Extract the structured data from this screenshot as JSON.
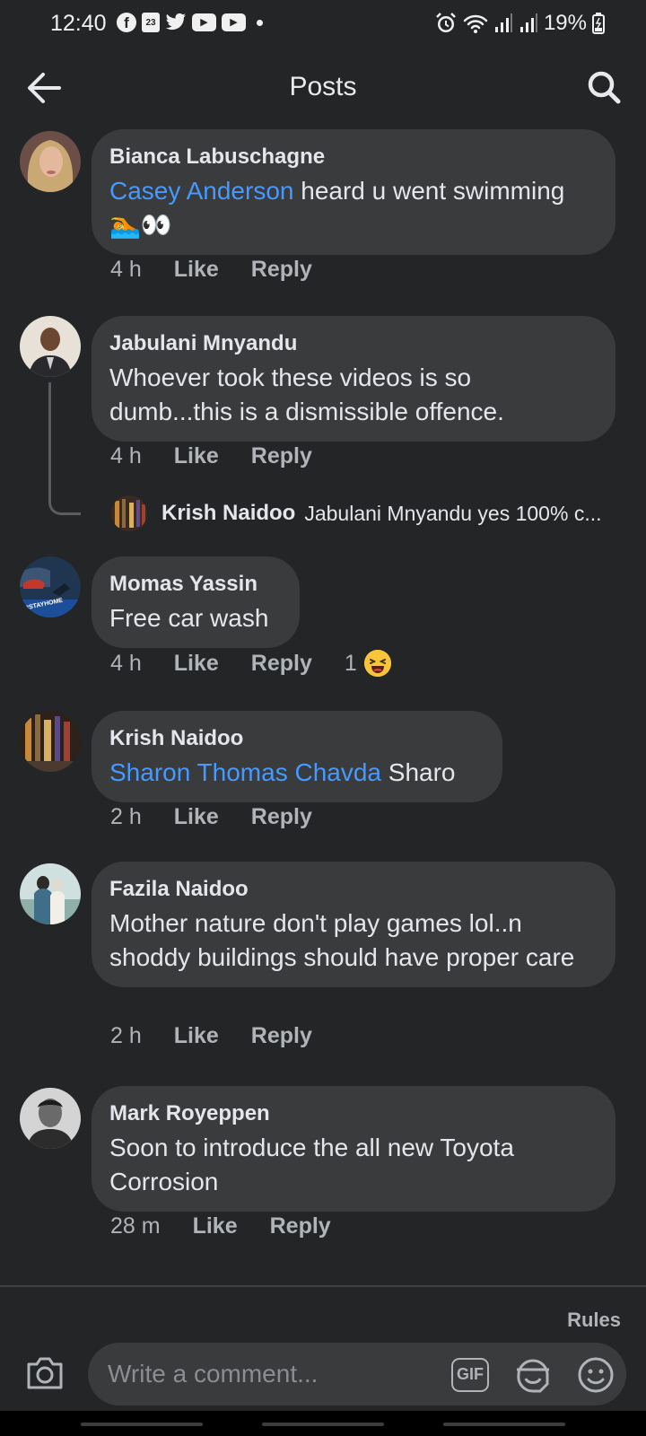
{
  "status_bar": {
    "time": "12:40",
    "calendar_day": "23",
    "battery": "19%"
  },
  "header": {
    "title": "Posts"
  },
  "comments": [
    {
      "author": "Bianca Labuschagne",
      "mention": "Casey Anderson",
      "text": " heard u went swimming",
      "text2": "🏊👀",
      "time": "4 h",
      "like": "Like",
      "reply": "Reply"
    },
    {
      "author": "Jabulani Mnyandu",
      "text": "Whoever took these videos is so dumb...this is a dismissible offence.",
      "time": "4 h",
      "like": "Like",
      "reply": "Reply",
      "reply_preview": {
        "author": "Krish Naidoo",
        "text": "Jabulani Mnyandu yes 100% c..."
      }
    },
    {
      "author": "Momas Yassin",
      "text": "Free car wash",
      "time": "4 h",
      "like": "Like",
      "reply": "Reply",
      "reaction_count": "1",
      "avatar_badge": "#STAYHOME"
    },
    {
      "author": "Krish Naidoo",
      "mention": "Sharon Thomas Chavda",
      "text": " Sharo",
      "time": "2 h",
      "like": "Like",
      "reply": "Reply"
    },
    {
      "author": "Fazila Naidoo",
      "text": "Mother nature don't play games lol..n shoddy buildings should have proper care",
      "time": "2 h",
      "like": "Like",
      "reply": "Reply"
    },
    {
      "author": "Mark Royeppen",
      "text": "Soon to introduce the all new Toyota Corrosion",
      "time": "28 m",
      "like": "Like",
      "reply": "Reply"
    }
  ],
  "composer": {
    "rules": "Rules",
    "placeholder": "Write a comment...",
    "gif_label": "GIF"
  },
  "colors": {
    "background": "#242526",
    "bubble": "#3a3b3c",
    "mention": "#4599ff",
    "secondary_text": "#b0b3b8"
  },
  "icons": [
    "back-arrow-icon",
    "search-icon",
    "camera-icon",
    "gif-icon",
    "sticker-icon",
    "emoji-icon",
    "laughing-emoji-icon"
  ]
}
